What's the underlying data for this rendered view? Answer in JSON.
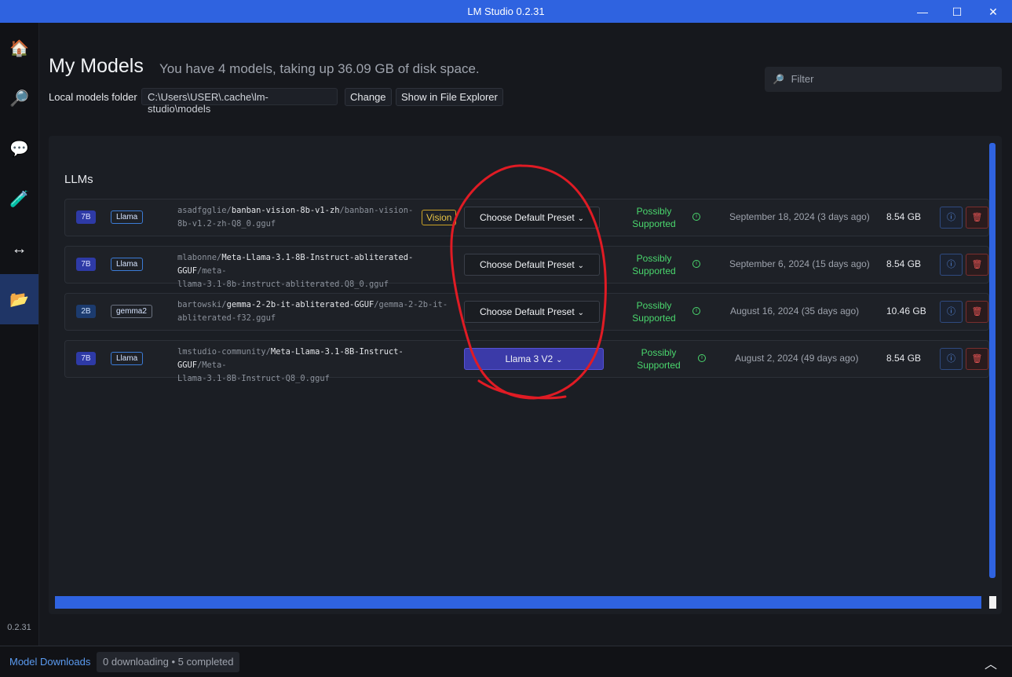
{
  "window": {
    "title": "LM Studio 0.2.31",
    "minimize": "—",
    "maximize": "☐",
    "close": "✕"
  },
  "sidebar": {
    "items": [
      {
        "name": "home",
        "icon": "🏠"
      },
      {
        "name": "search",
        "icon": "🔎"
      },
      {
        "name": "chat",
        "icon": "💬"
      },
      {
        "name": "playground",
        "icon": "🧪"
      },
      {
        "name": "server",
        "icon": "↔"
      },
      {
        "name": "my-models",
        "icon": "📂"
      }
    ],
    "version": "0.2.31"
  },
  "header": {
    "title": "My Models",
    "subtitle": "You have 4 models, taking up 36.09 GB of disk space.",
    "folder_label": "Local models folder",
    "folder_path": "C:\\Users\\USER\\.cache\\lm-studio\\models",
    "change_label": "Change",
    "show_explorer_label": "Show in File Explorer",
    "filter_placeholder": "Filter",
    "filter_icon": "🔎"
  },
  "section": {
    "title": "LLMs"
  },
  "models": [
    {
      "size": "7B",
      "arch": "Llama",
      "owner": "asadfgglie/",
      "repo": "banban-vision-8b-v1-zh",
      "file_line1": "/banban-vision-",
      "file_line2": "8b-v1.2-zh-Q8_0.gguf",
      "tag": "Vision",
      "preset": "Choose Default Preset",
      "support_line1": "Possibly",
      "support_line2": "Supported",
      "date": "September 18, 2024 (3 days ago)",
      "file_size": "8.54 GB"
    },
    {
      "size": "7B",
      "arch": "Llama",
      "owner": "mlabonne/",
      "repo": "Meta-Llama-3.1-8B-Instruct-abliterated-GGUF",
      "file_line1": "/meta-",
      "file_line2": "llama-3.1-8b-instruct-abliterated.Q8_0.gguf",
      "tag": "",
      "preset": "Choose Default Preset",
      "support_line1": "Possibly",
      "support_line2": "Supported",
      "date": "September 6, 2024 (15 days ago)",
      "file_size": "8.54 GB"
    },
    {
      "size": "2B",
      "arch": "gemma2",
      "owner": "bartowski/",
      "repo": "gemma-2-2b-it-abliterated-GGUF",
      "file_line1": "/gemma-2-2b-it-",
      "file_line2": "abliterated-f32.gguf",
      "tag": "",
      "preset": "Choose Default Preset",
      "support_line1": "Possibly",
      "support_line2": "Supported",
      "date": "August 16, 2024 (35 days ago)",
      "file_size": "10.46 GB"
    },
    {
      "size": "7B",
      "arch": "Llama",
      "owner": "lmstudio-community/",
      "repo": "Meta-Llama-3.1-8B-Instruct-GGUF",
      "file_line1": "/Meta-",
      "file_line2": "Llama-3.1-8B-Instruct-Q8_0.gguf",
      "tag": "",
      "preset": "Llama 3 V2",
      "support_line1": "Possibly",
      "support_line2": "Supported",
      "date": "August 2, 2024 (49 days ago)",
      "file_size": "8.54 GB"
    }
  ],
  "icons": {
    "chevron": "⌄",
    "info": "ⓘ",
    "delete": "🗑",
    "support_info": "i"
  },
  "footer": {
    "downloads_label": "Model Downloads",
    "downloads_status": "0 downloading • 5 completed",
    "expand_icon": "︿"
  },
  "colors": {
    "accent": "#2f63e0",
    "supported": "#4ad66d",
    "annotation": "#e01b24"
  }
}
